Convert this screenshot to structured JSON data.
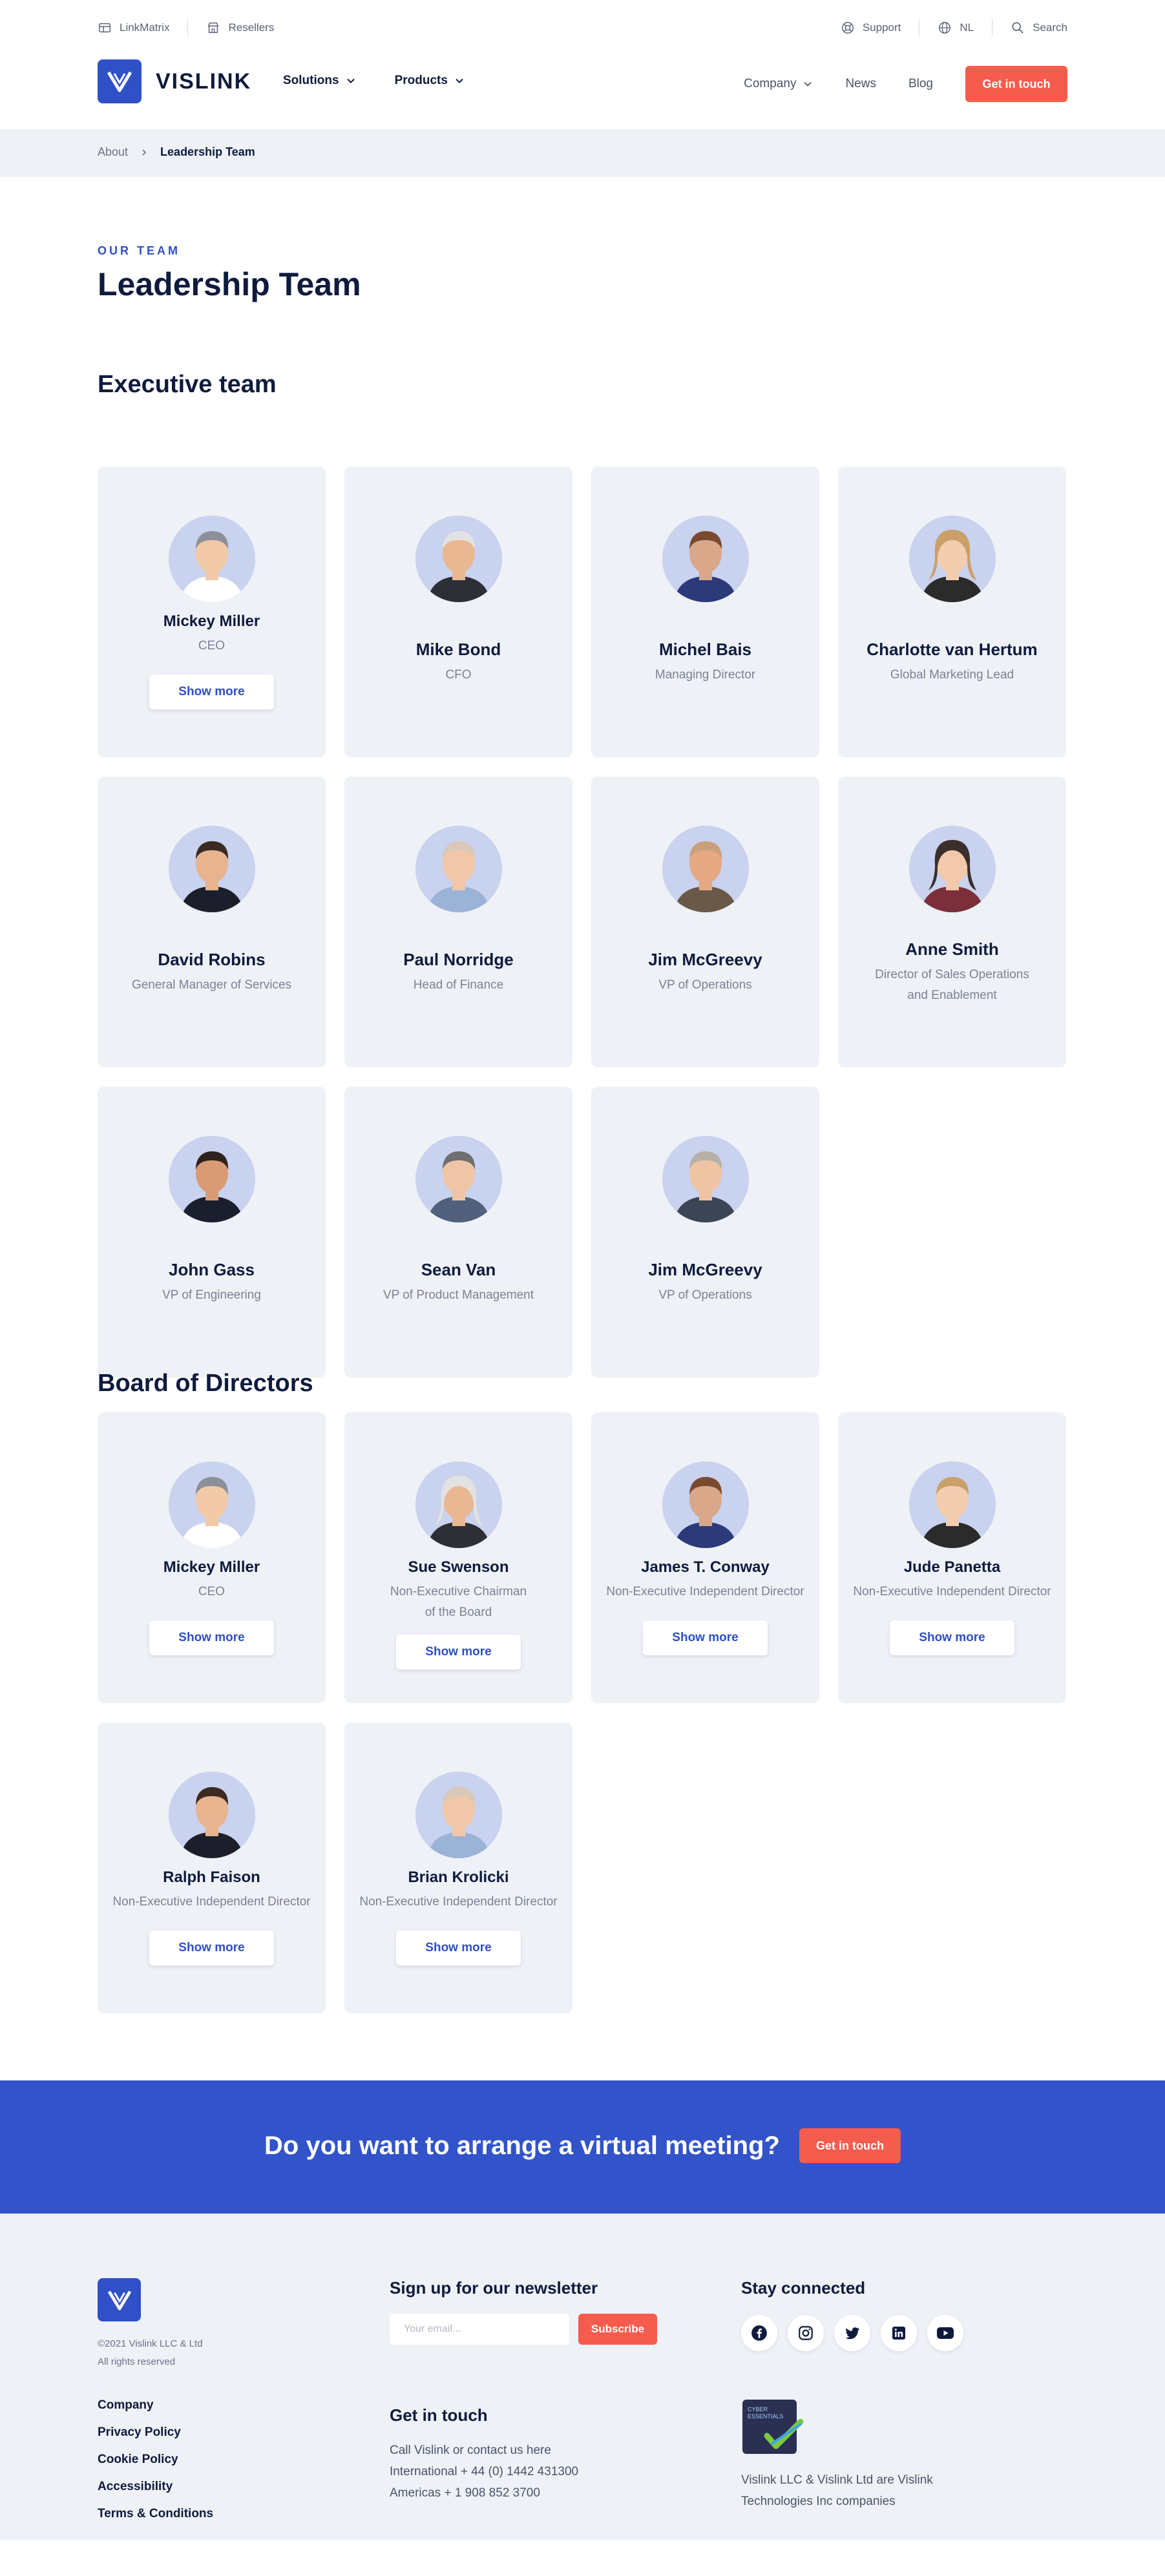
{
  "utility": {
    "left": [
      {
        "label": "LinkMatrix",
        "icon": "grid-icon"
      },
      {
        "label": "Resellers",
        "icon": "store-icon"
      }
    ],
    "right": [
      {
        "label": "Support",
        "icon": "lifebuoy-icon"
      },
      {
        "label": "NL",
        "icon": "globe-icon"
      },
      {
        "label": "Search",
        "icon": "search-icon"
      }
    ]
  },
  "nav": {
    "brand": "VISLINK",
    "main": [
      "Solutions",
      "Products"
    ],
    "company": "Company",
    "news": "News",
    "blog": "Blog",
    "cta": "Get in touch"
  },
  "breadcrumb": {
    "parent": "About",
    "current": "Leadership Team"
  },
  "intro": {
    "eyebrow": "OUR TEAM",
    "title": "Leadership Team"
  },
  "executive": {
    "title": "Executive team",
    "people": [
      {
        "name": "Mickey Miller",
        "role": "CEO",
        "more": "Show more"
      },
      {
        "name": "Mike Bond",
        "role": "CFO"
      },
      {
        "name": "Michel Bais",
        "role": "Managing Director"
      },
      {
        "name": "Charlotte van Hertum",
        "role": "Global Marketing Lead"
      },
      {
        "name": "David Robins",
        "role": "General Manager of Services"
      },
      {
        "name": "Paul Norridge",
        "role": "Head of Finance"
      },
      {
        "name": "Jim McGreevy",
        "role": "VP of Operations"
      },
      {
        "name": "Anne Smith",
        "role": "Director of Sales Operations and Enablement"
      },
      {
        "name": "John Gass",
        "role": "VP of Engineering"
      },
      {
        "name": "Sean Van",
        "role": "VP of Product Management"
      },
      {
        "name": "Jim McGreevy",
        "role": "VP of Operations"
      }
    ]
  },
  "board": {
    "title": "Board of Directors",
    "people": [
      {
        "name": "Mickey Miller",
        "role": "CEO",
        "more": "Show more"
      },
      {
        "name": "Sue Swenson",
        "role": "Non-Executive Chairman of the Board",
        "more": "Show more"
      },
      {
        "name": "James T. Conway",
        "role": "Non-Executive Independent Director",
        "more": "Show more"
      },
      {
        "name": "Jude Panetta",
        "role": "Non-Executive Independent Director",
        "more": "Show more"
      },
      {
        "name": "Ralph Faison",
        "role": "Non-Executive Independent Director",
        "more": "Show more"
      },
      {
        "name": "Brian Krolicki",
        "role": "Non-Executive Independent Director",
        "more": "Show more"
      }
    ]
  },
  "cta": {
    "text": "Do you want to arrange a virtual meeting?",
    "button": "Get in touch"
  },
  "footer": {
    "copyright": "©2021 Vislink LLC & Ltd",
    "rights": "All rights reserved",
    "links": [
      "Company",
      "Privacy Policy",
      "Cookie Policy",
      "Accessibility",
      "Terms & Conditions"
    ],
    "newsletter": {
      "title": "Sign up for our newsletter",
      "placeholder": "Your email...",
      "button": "Subscribe"
    },
    "contact": {
      "title": "Get in touch",
      "lines": [
        "Call Vislink or contact us here",
        "International + 44 (0) 1442 431300",
        "Americas + 1 908 852 3700"
      ]
    },
    "social": {
      "title": "Stay connected",
      "icons": [
        "facebook-icon",
        "instagram-icon",
        "twitter-icon",
        "linkedin-icon",
        "youtube-icon"
      ]
    },
    "badge": {
      "line1": "CYBER",
      "line2": "ESSENTIALS"
    },
    "note": "Vislink LLC & Vislink Ltd are Vislink Technologies Inc companies"
  },
  "colors": {
    "brand": "#3050c8",
    "accent": "#f65c4e",
    "card": "#eef1f6",
    "ink": "#0f1b3d"
  }
}
